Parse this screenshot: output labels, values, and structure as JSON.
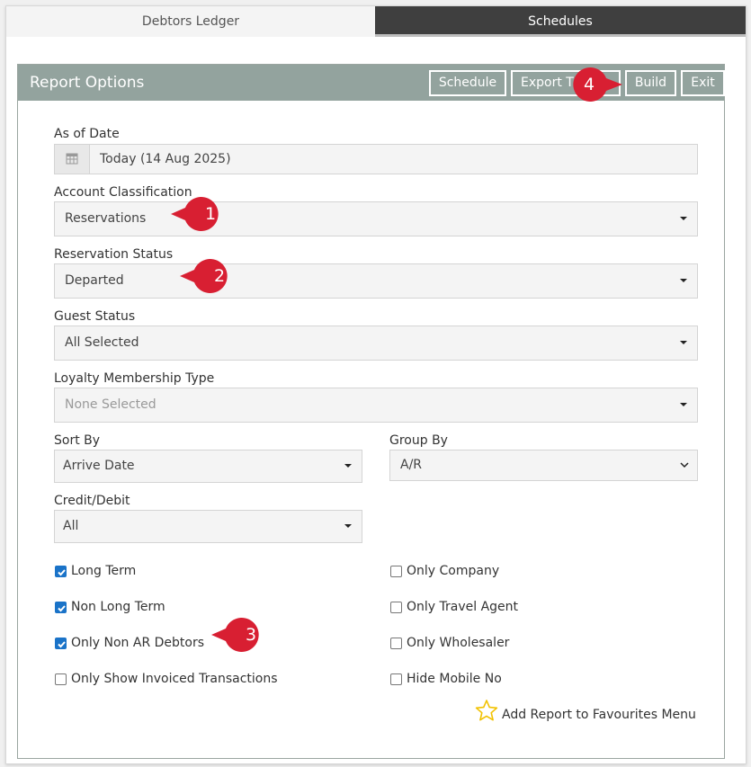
{
  "tabs": [
    "Debtors Ledger",
    "Schedules"
  ],
  "panel": {
    "title": "Report Options",
    "buttons": {
      "schedule": "Schedule",
      "export": "Export T",
      "build": "Build",
      "exit": "Exit"
    }
  },
  "fields": {
    "as_of_date": {
      "label": "As of Date",
      "value": "Today (14 Aug 2025)"
    },
    "account_classification": {
      "label": "Account Classification",
      "value": "Reservations"
    },
    "reservation_status": {
      "label": "Reservation Status",
      "value": "Departed"
    },
    "guest_status": {
      "label": "Guest Status",
      "value": "All Selected"
    },
    "loyalty_membership_type": {
      "label": "Loyalty Membership Type",
      "placeholder": "None Selected"
    },
    "sort_by": {
      "label": "Sort By",
      "value": "Arrive Date"
    },
    "group_by": {
      "label": "Group By",
      "value": "A/R"
    },
    "credit_debit": {
      "label": "Credit/Debit",
      "value": "All"
    }
  },
  "checkboxes": {
    "long_term": {
      "label": "Long Term",
      "checked": true
    },
    "non_long_term": {
      "label": "Non Long Term",
      "checked": true
    },
    "only_non_ar_debtors": {
      "label": "Only Non AR Debtors",
      "checked": true
    },
    "only_show_invoiced": {
      "label": "Only Show Invoiced Transactions",
      "checked": false
    },
    "only_company": {
      "label": "Only Company",
      "checked": false
    },
    "only_travel_agent": {
      "label": "Only Travel Agent",
      "checked": false
    },
    "only_wholesaler": {
      "label": "Only Wholesaler",
      "checked": false
    },
    "hide_mobile_no": {
      "label": "Hide Mobile No",
      "checked": false
    }
  },
  "favourites": {
    "label": "Add Report to Favourites Menu"
  },
  "badges": [
    "1",
    "2",
    "3",
    "4"
  ],
  "colors": {
    "header": "#93a39e",
    "checkbox": "#1a73c8",
    "badge": "#d81f32",
    "star": "#f2c200"
  },
  "icons": [
    "calendar-icon",
    "dropdown-caret-icon",
    "chevron-down-icon",
    "checkmark-icon",
    "star-icon"
  ]
}
